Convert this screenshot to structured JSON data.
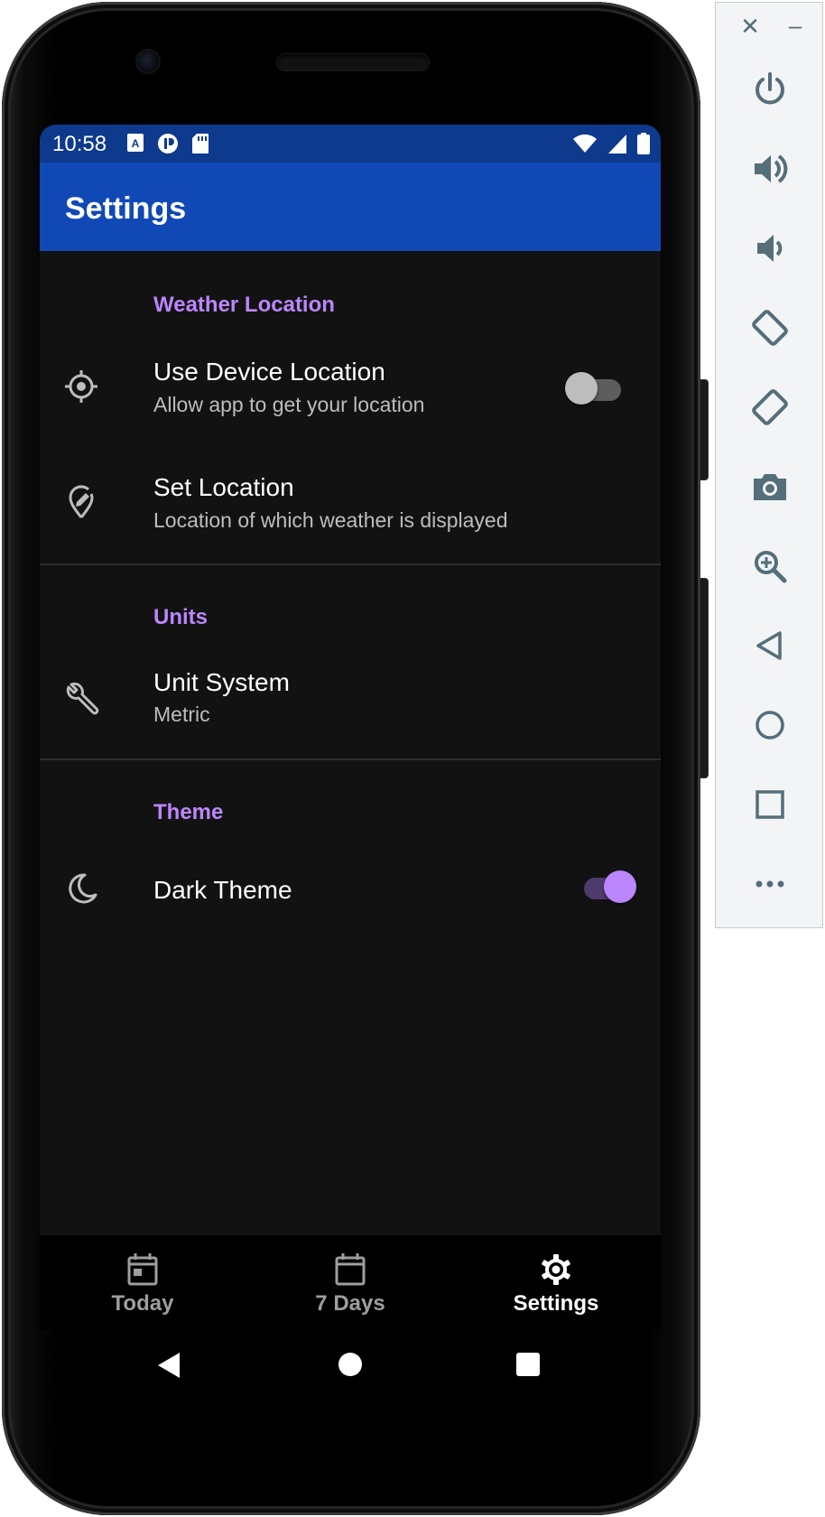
{
  "status_bar": {
    "time": "10:58"
  },
  "app_bar": {
    "title": "Settings"
  },
  "preferences": {
    "weather_location": {
      "category": "Weather Location",
      "use_device_location": {
        "title": "Use Device Location",
        "summary": "Allow app to get your location",
        "enabled": false
      },
      "set_location": {
        "title": "Set Location",
        "summary": "Location of which weather is displayed"
      }
    },
    "units": {
      "category": "Units",
      "unit_system": {
        "title": "Unit System",
        "summary": "Metric"
      }
    },
    "theme": {
      "category": "Theme",
      "dark_theme": {
        "title": "Dark Theme",
        "enabled": true
      }
    }
  },
  "bottom_nav": {
    "items": [
      {
        "label": "Today",
        "icon": "calendar-icon",
        "selected": false
      },
      {
        "label": "7 Days",
        "icon": "calendar-icon",
        "selected": false
      },
      {
        "label": "Settings",
        "icon": "gear-icon",
        "selected": true
      }
    ]
  },
  "colors": {
    "status_bar": "#0d3a8c",
    "app_bar": "#1049b5",
    "background": "#121212",
    "accent": "#bb86fc",
    "nav_inactive": "#9e9e9e",
    "nav_active": "#ffffff"
  },
  "emulator_panel": {
    "buttons": [
      "power-icon",
      "volume-up-icon",
      "volume-down-icon",
      "rotate-left-icon",
      "rotate-right-icon",
      "camera-icon",
      "zoom-icon",
      "back-icon",
      "home-icon",
      "overview-icon",
      "more-icon"
    ]
  }
}
